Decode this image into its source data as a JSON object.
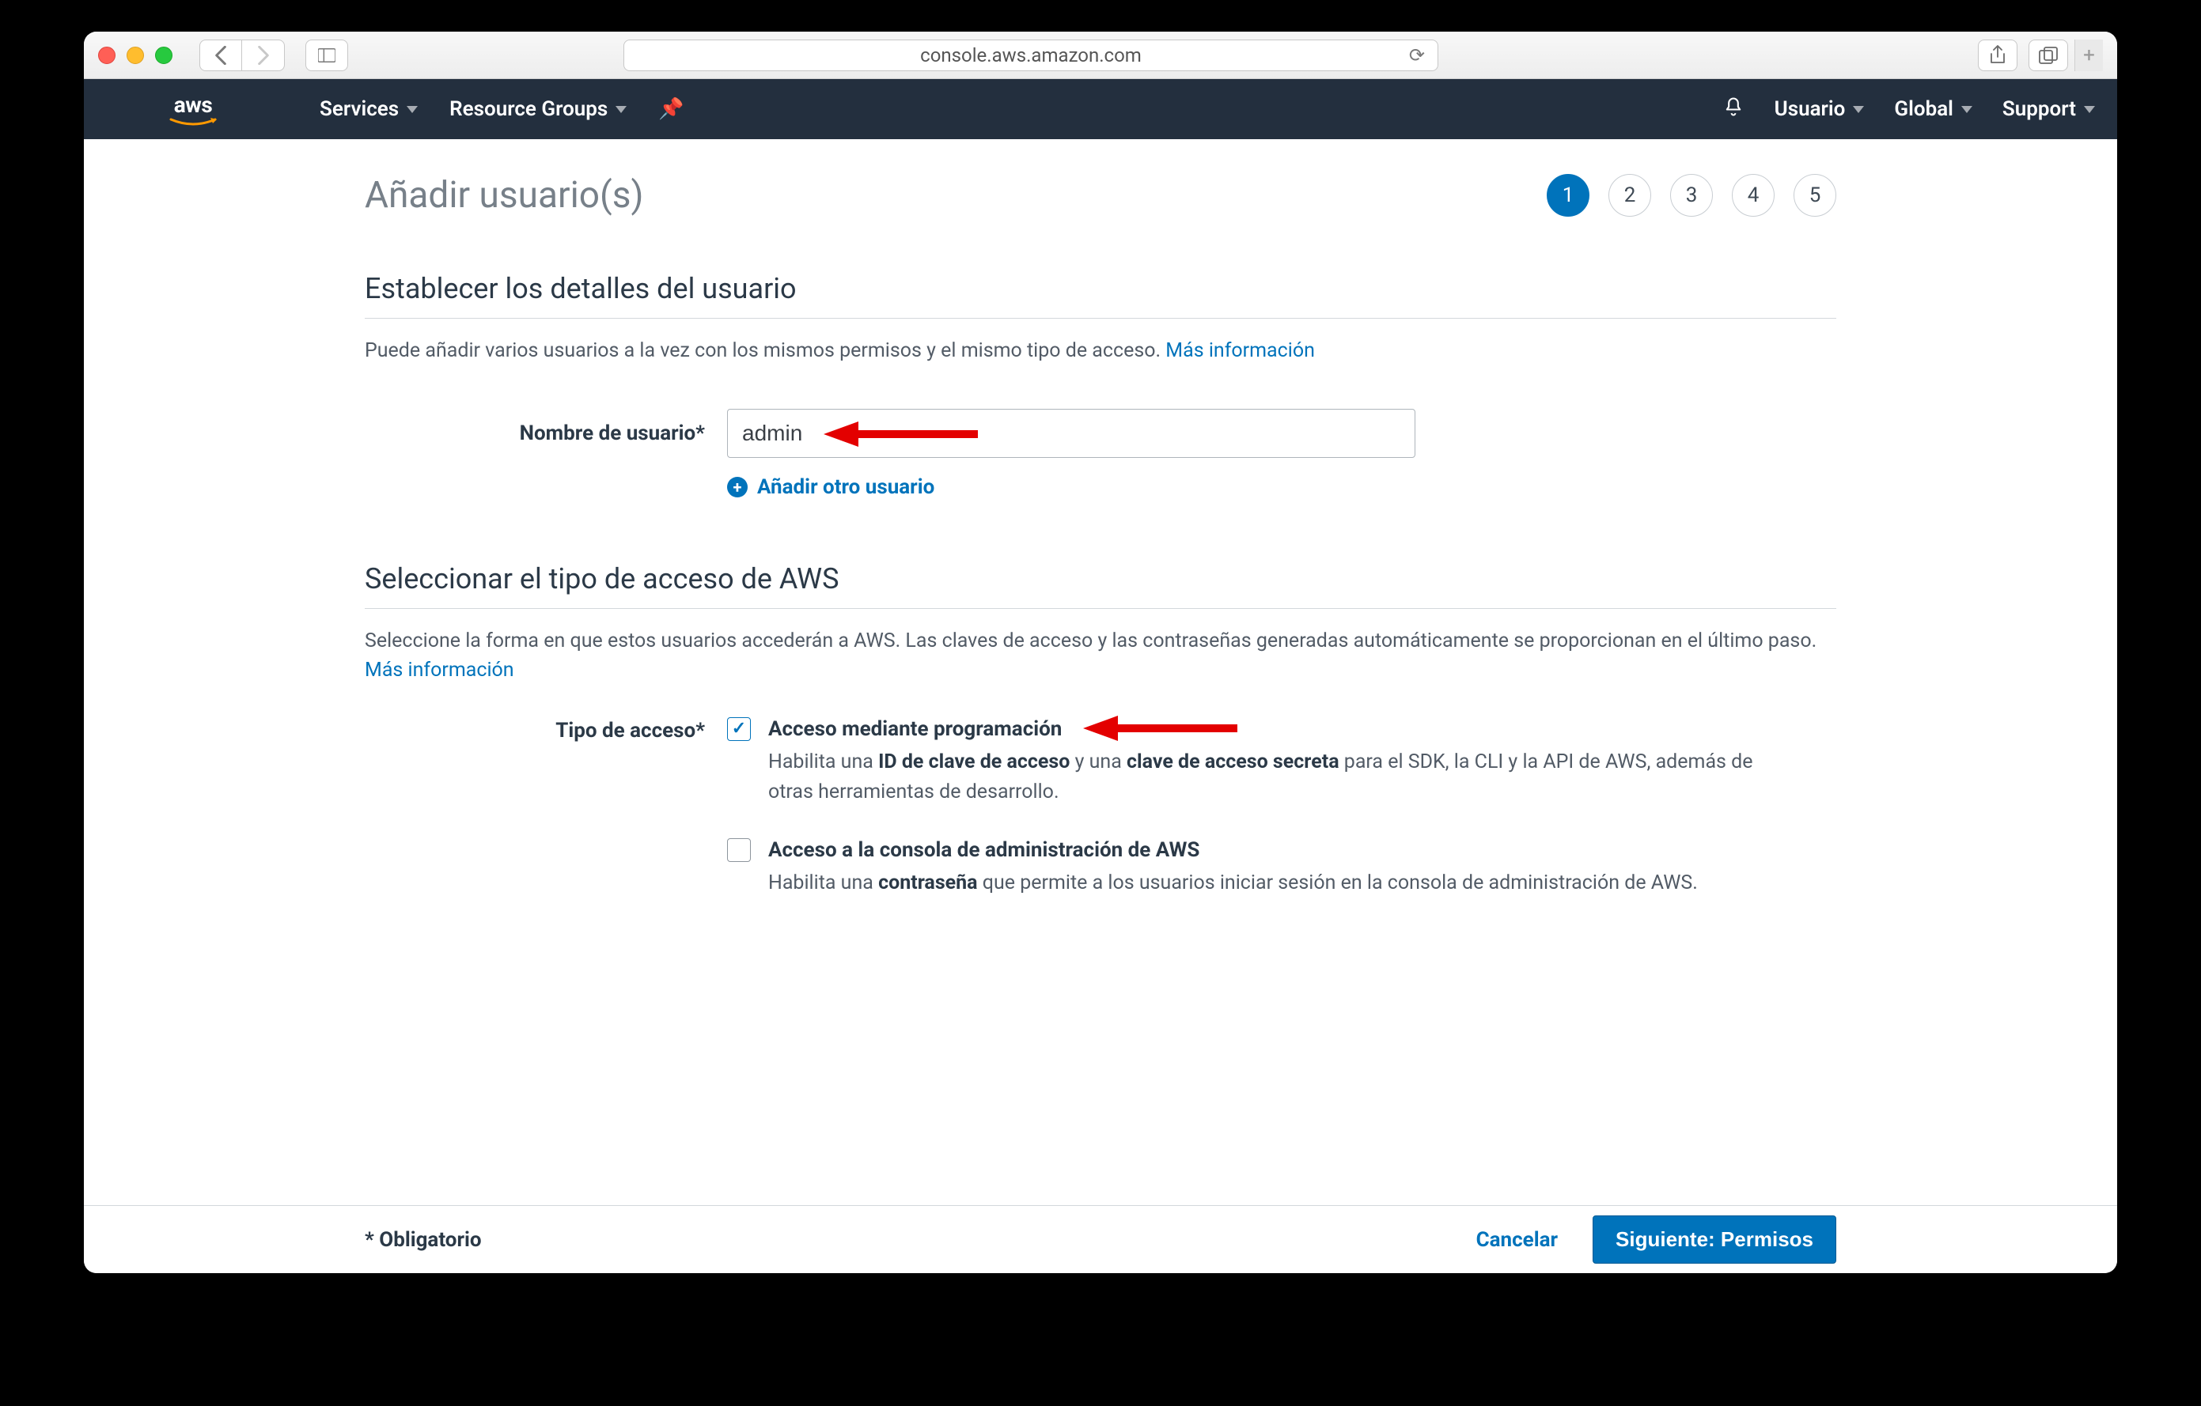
{
  "browser": {
    "url": "console.aws.amazon.com"
  },
  "aws_header": {
    "services": "Services",
    "resource_groups": "Resource Groups",
    "user": "Usuario",
    "region": "Global",
    "support": "Support"
  },
  "page": {
    "title": "Añadir usuario(s)",
    "steps": [
      "1",
      "2",
      "3",
      "4",
      "5"
    ],
    "active_step_index": 0,
    "section_details": {
      "heading": "Establecer los detalles del usuario",
      "sub_text": "Puede añadir varios usuarios a la vez con los mismos permisos y el mismo tipo de acceso. ",
      "more_info": "Más información",
      "username_label": "Nombre de usuario*",
      "username_value": "admin",
      "add_user": "Añadir otro usuario"
    },
    "section_access": {
      "heading": "Seleccionar el tipo de acceso de AWS",
      "sub_text": "Seleccione la forma en que estos usuarios accederán a AWS. Las claves de acceso y las contraseñas generadas automáticamente se proporcionan en el último paso. ",
      "more_info": "Más información",
      "label": "Tipo de acceso*",
      "options": [
        {
          "checked": true,
          "title": "Acceso mediante programación",
          "desc_pre": "Habilita una ",
          "desc_b1": "ID de clave de acceso",
          "desc_mid": " y una ",
          "desc_b2": "clave de acceso secreta",
          "desc_post": " para el SDK, la CLI y la API de AWS, además de otras herramientas de desarrollo."
        },
        {
          "checked": false,
          "title": "Acceso a la consola de administración de AWS",
          "desc_pre": "Habilita una ",
          "desc_b1": "contraseña",
          "desc_mid": "",
          "desc_b2": "",
          "desc_post": " que permite a los usuarios iniciar sesión en la consola de administración de AWS."
        }
      ]
    },
    "footer": {
      "required": "* Obligatorio",
      "cancel": "Cancelar",
      "next": "Siguiente: Permisos"
    }
  }
}
